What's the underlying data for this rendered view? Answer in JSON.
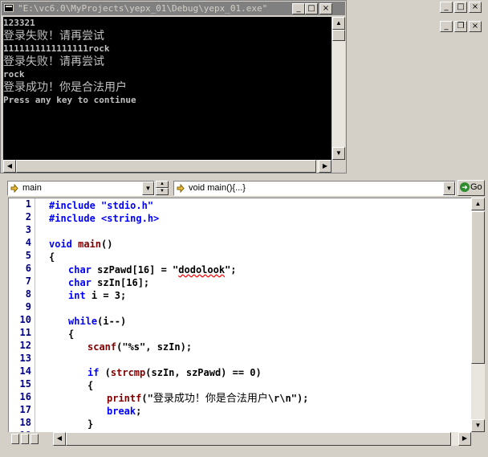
{
  "console": {
    "title": "\"E:\\vc6.0\\MyProjects\\yepx_01\\Debug\\yepx_01.exe\"",
    "lines": [
      "123321",
      "登录失败！请再尝试",
      "1111111111111111rock",
      "登录失败！请再尝试",
      "rock",
      "登录成功！你是合法用户",
      "Press any key to continue"
    ]
  },
  "window_buttons": {
    "minimize": "_",
    "maximize": "□",
    "close": "×",
    "restore": "❐"
  },
  "wizard": {
    "scope_value": "main",
    "member_value": "void main(){...}",
    "go_label": "Go"
  },
  "editor": {
    "line_numbers": [
      "1",
      "2",
      "3",
      "4",
      "5",
      "6",
      "7",
      "8",
      "9",
      "10",
      "11",
      "12",
      "13",
      "14",
      "15",
      "16",
      "17",
      "18",
      "19"
    ],
    "code": {
      "l1": "#include \"stdio.h\"",
      "l2": "#include <string.h>",
      "l4_kw": "void",
      "l4_fn": " main",
      "l4_rest": "()",
      "l5": "{",
      "l6_kw": "char",
      "l6_a": " szPawd[16] = \"",
      "l6_sq": "dodolook",
      "l6_b": "\";",
      "l7_kw": "char",
      "l7_rest": " szIn[16];",
      "l8_kw": "int",
      "l8_rest": " i = 3;",
      "l10_kw": "while",
      "l10_rest": "(i--)",
      "l11": "{",
      "l12_fn": "scanf",
      "l12_rest": "(\"%s\", szIn);",
      "l14_kw": "if",
      "l14_a": " (",
      "l14_fn": "strcmp",
      "l14_b": "(szIn, szPawd) == 0)",
      "l15": "{",
      "l16_fn": "printf",
      "l16_a": "(\"",
      "l16_cjk": "登录成功！你是合法用户",
      "l16_b": "\\r\\n\");",
      "l17_kw": "break",
      "l17_rest": ";",
      "l18": "}"
    }
  },
  "colors": {
    "keyword": "#0000ff",
    "function": "#800000",
    "line_number": "#000080",
    "console_bg": "#000000",
    "console_fg": "#c0c0c0"
  },
  "icons": [
    "console-app-icon",
    "wizard-arrow-icon",
    "go-icon"
  ]
}
